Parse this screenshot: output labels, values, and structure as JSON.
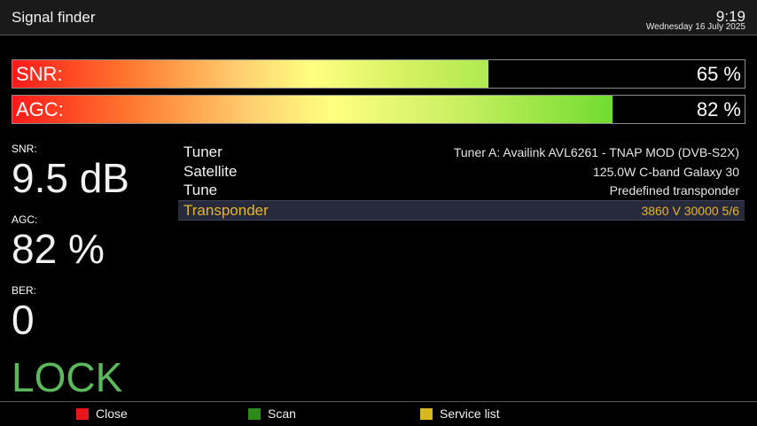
{
  "header": {
    "title": "Signal finder",
    "time": "9:19",
    "date": "Wednesday 16 July 2025"
  },
  "bars": {
    "snr": {
      "label": "SNR:",
      "value_text": "65 %",
      "level": 0.65
    },
    "agc": {
      "label": "AGC:",
      "value_text": "82 %",
      "level": 0.82
    }
  },
  "stats": {
    "snr_label": "SNR:",
    "snr_value": "9.5 dB",
    "agc_label": "AGC:",
    "agc_value": "82 %",
    "ber_label": "BER:",
    "ber_value": "0",
    "lock_status": "LOCK"
  },
  "info": [
    {
      "key": "Tuner",
      "value": "Tuner A: Availink AVL6261 - TNAP MOD (DVB-S2X)"
    },
    {
      "key": "Satellite",
      "value": "125.0W C-band Galaxy 30"
    },
    {
      "key": "Tune",
      "value": "Predefined transponder"
    },
    {
      "key": "Transponder",
      "value": "3860 V 30000 5/6",
      "selected": true
    }
  ],
  "footer": {
    "red_label": "Close",
    "green_label": "Scan",
    "yellow_label": "Service list",
    "colors": {
      "red": "#e8161a",
      "green": "#2e8b18",
      "yellow": "#d9b81c"
    }
  },
  "colors": {
    "lock": "#5cb85c",
    "selected_text": "#e6b52a"
  }
}
